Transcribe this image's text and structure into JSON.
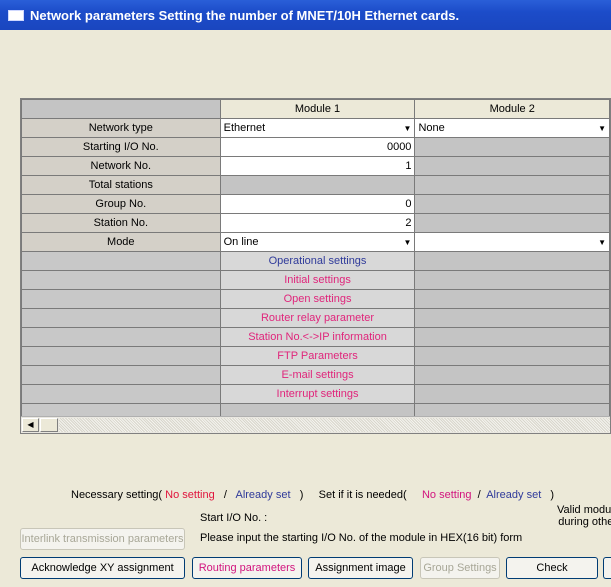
{
  "window": {
    "title": "Network parameters  Setting the number of MNET/10H Ethernet cards."
  },
  "grid": {
    "columns": [
      "Module 1",
      "Module 2"
    ],
    "rows": {
      "network_type": {
        "label": "Network type",
        "m1": "Ethernet",
        "m2": "None"
      },
      "starting_io": {
        "label": "Starting I/O No.",
        "m1": "0000"
      },
      "network_no": {
        "label": "Network No.",
        "m1": "1"
      },
      "total_stations": {
        "label": "Total stations"
      },
      "group_no": {
        "label": "Group No.",
        "m1": "0"
      },
      "station_no": {
        "label": "Station No.",
        "m1": "2"
      },
      "mode": {
        "label": "Mode",
        "m1": "On line"
      }
    },
    "settings_buttons": {
      "operational": "Operational settings",
      "initial": "Initial settings",
      "open": "Open settings",
      "router": "Router relay parameter",
      "station_ip": "Station No.<->IP information",
      "ftp": "FTP Parameters",
      "email": "E-mail settings",
      "interrupt": "Interrupt settings"
    }
  },
  "legend": {
    "necessary": "Necessary setting(",
    "no_setting_1": "No setting",
    "slash_1": "/",
    "already_set_1": "Already set",
    "close_1": ")",
    "if_needed": "Set if it is needed(",
    "no_setting_2": "No setting",
    "slash_2": "/",
    "already_set_2": "Already set",
    "close_2": ")"
  },
  "info": {
    "label": "Start I/O No. :",
    "text": "Please input the starting I/O No. of the module in HEX(16 bit) form",
    "valid_line1": "Valid module",
    "valid_line2": "during other"
  },
  "buttons": {
    "interlink": "Interlink transmission parameters",
    "acknowledge": "Acknowledge XY assignment",
    "routing": "Routing parameters",
    "assignment": "Assignment image",
    "group": "Group Settings",
    "check": "Check"
  }
}
